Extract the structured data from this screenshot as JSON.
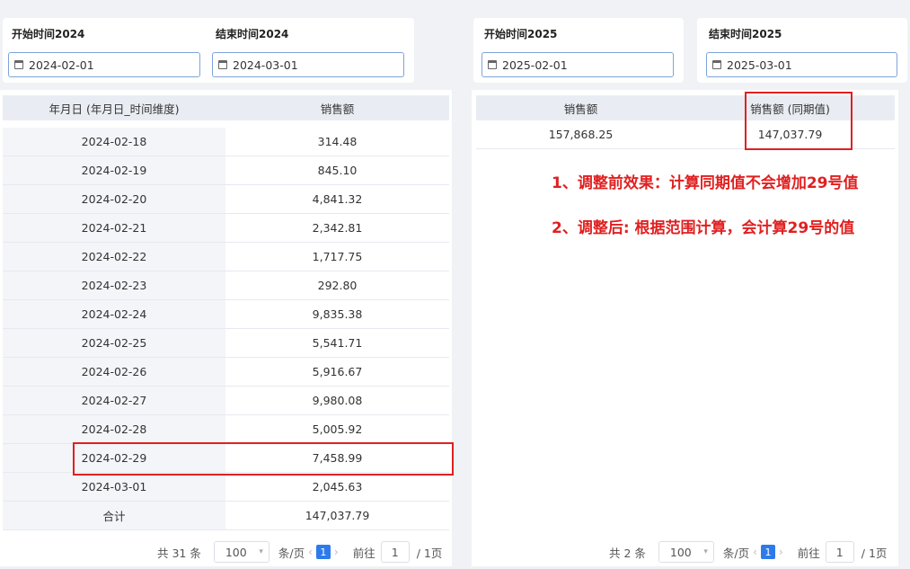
{
  "filters": [
    {
      "label": "开始时间2024",
      "value": "2024-02-01"
    },
    {
      "label": "结束时间2024",
      "value": "2024-03-01"
    },
    {
      "label": "开始时间2025",
      "value": "2025-02-01"
    },
    {
      "label": "结束时间2025",
      "value": "2025-03-01"
    }
  ],
  "left_table": {
    "headers": [
      "年月日 (年月日_时间维度)",
      "销售额"
    ],
    "rows": [
      [
        "2024-02-18",
        "314.48"
      ],
      [
        "2024-02-19",
        "845.10"
      ],
      [
        "2024-02-20",
        "4,841.32"
      ],
      [
        "2024-02-21",
        "2,342.81"
      ],
      [
        "2024-02-22",
        "1,717.75"
      ],
      [
        "2024-02-23",
        "292.80"
      ],
      [
        "2024-02-24",
        "9,835.38"
      ],
      [
        "2024-02-25",
        "5,541.71"
      ],
      [
        "2024-02-26",
        "5,916.67"
      ],
      [
        "2024-02-27",
        "9,980.08"
      ],
      [
        "2024-02-28",
        "5,005.92"
      ],
      [
        "2024-02-29",
        "7,458.99"
      ],
      [
        "2024-03-01",
        "2,045.63"
      ],
      [
        "合计",
        "147,037.79"
      ]
    ],
    "pager": {
      "total": "共 31 条",
      "page_size": "100",
      "per_page": "条/页",
      "page": "1",
      "goto": "前往",
      "goto_value": "1",
      "pages": "/ 1页"
    }
  },
  "right_table": {
    "headers": [
      "销售额",
      "销售额 (同期值)"
    ],
    "rows": [
      [
        "157,868.25",
        "147,037.79"
      ]
    ],
    "pager": {
      "total": "共 2 条",
      "page_size": "100",
      "per_page": "条/页",
      "page": "1",
      "goto": "前往",
      "goto_value": "1",
      "pages": "/ 1页"
    }
  },
  "annotations": [
    "1、调整前效果：计算同期值不会增加29号值",
    "2、调整后: 根据范围计算，会计算29号的值"
  ],
  "colors": {
    "highlight": "#e02020",
    "accent": "#2d7bea"
  }
}
